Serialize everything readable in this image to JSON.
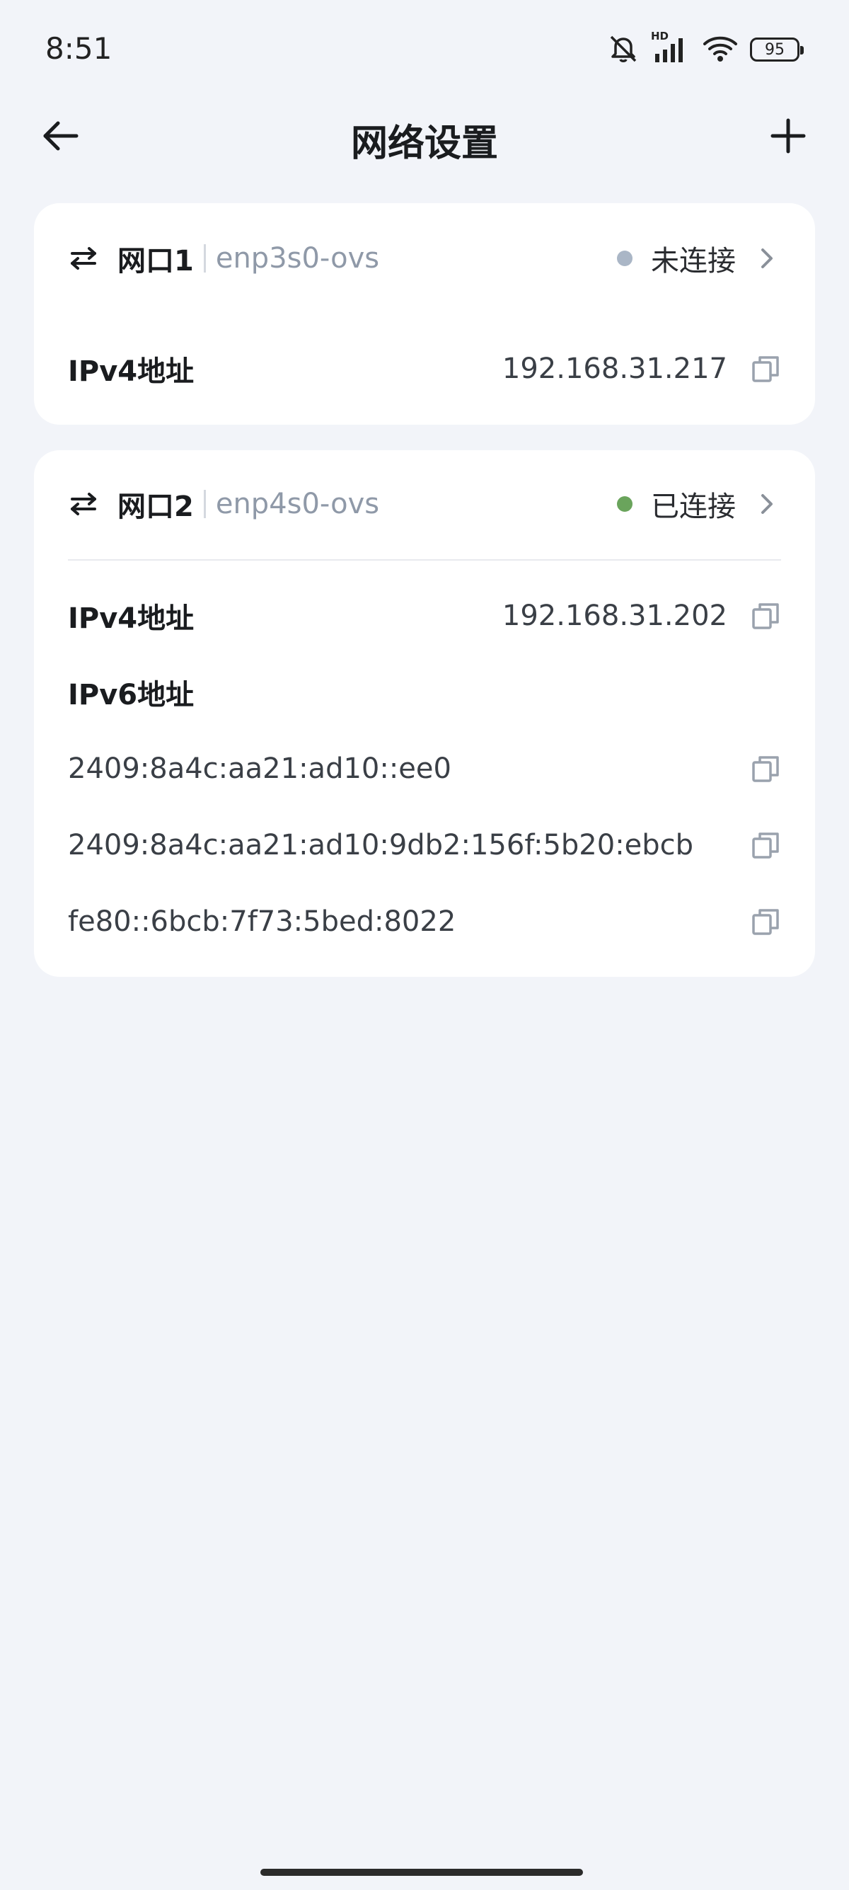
{
  "status_bar": {
    "time": "8:51",
    "network_label": "HD",
    "battery": "95"
  },
  "nav": {
    "title": "网络设置",
    "back_icon": "arrow-left-icon",
    "add_icon": "plus-icon"
  },
  "ports": [
    {
      "name": "网口1",
      "interface": "enp3s0-ovs",
      "status": "未连接",
      "status_color": "#aab6c6",
      "ipv4_label": "IPv4地址",
      "ipv4": "192.168.31.217"
    },
    {
      "name": "网口2",
      "interface": "enp4s0-ovs",
      "status": "已连接",
      "status_color": "#6aa45c",
      "ipv4_label": "IPv4地址",
      "ipv4": "192.168.31.202",
      "ipv6_label": "IPv6地址",
      "ipv6": [
        "2409:8a4c:aa21:ad10::ee0",
        "2409:8a4c:aa21:ad10:9db2:156f:5b20:ebcb",
        "fe80::6bcb:7f73:5bed:8022"
      ]
    }
  ]
}
